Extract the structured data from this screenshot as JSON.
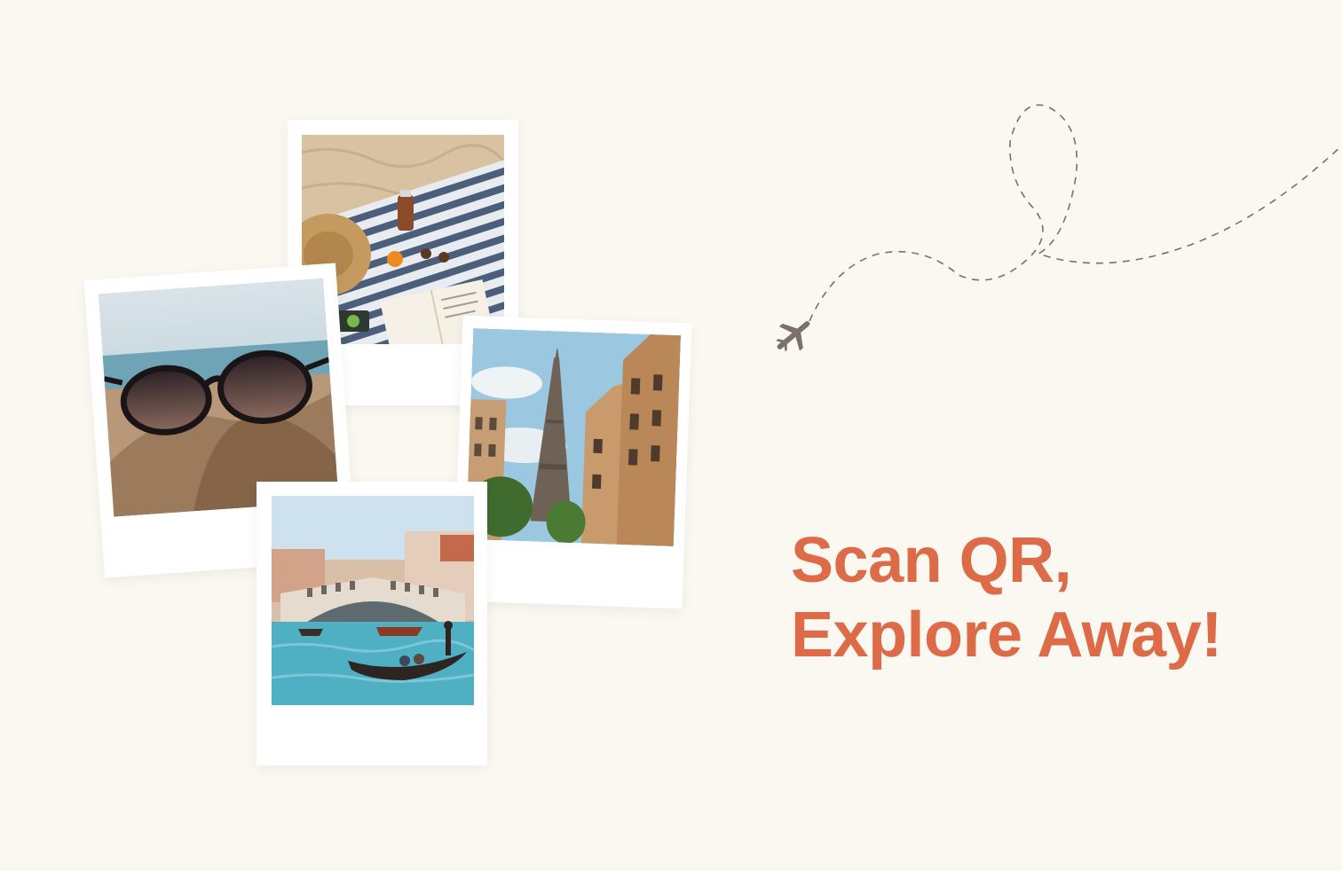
{
  "headline": {
    "line1": "Scan QR,",
    "line2": "Explore Away!"
  },
  "photos": [
    {
      "subject": "beach picnic blanket with book, hat and sunglasses"
    },
    {
      "subject": "Eiffel Tower between Paris buildings"
    },
    {
      "subject": "sunglasses resting on sand"
    },
    {
      "subject": "Venice canal with Rialto bridge and gondola"
    }
  ],
  "icons": {
    "airplane": "airplane-icon",
    "path": "dashed-flight-path"
  },
  "colors": {
    "background": "#FBF7F1",
    "accent": "#DD6B47",
    "frame": "#FFFFFF",
    "path": "#7A7168"
  }
}
